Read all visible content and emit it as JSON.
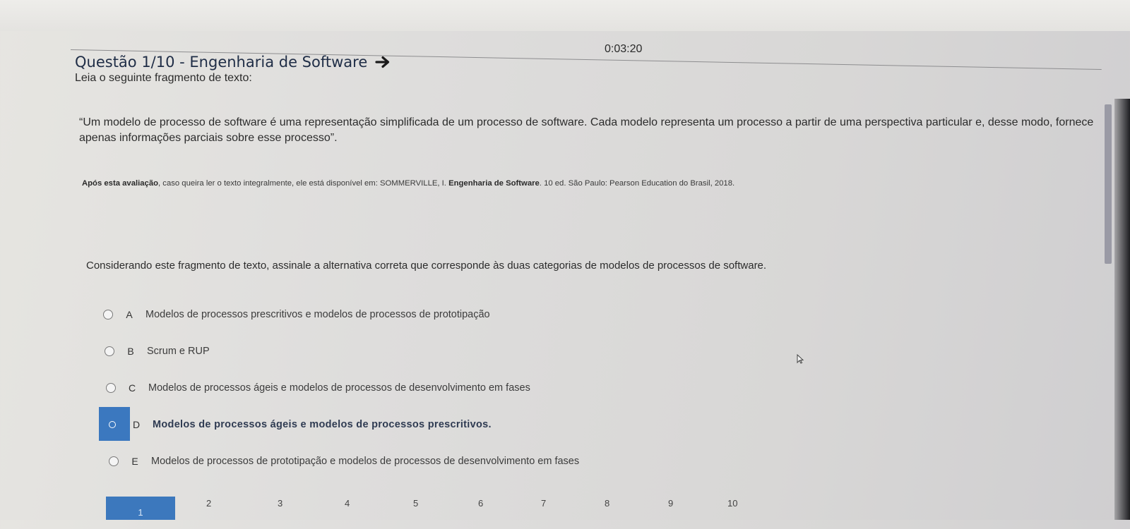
{
  "timer": "0:03:20",
  "question": {
    "title": "Questão 1/10 - Engenharia de Software",
    "intro": "Leia o seguinte fragmento de texto:",
    "quote": "“Um modelo de processo de software é uma representação simplificada de um processo de software. Cada modelo representa um processo a partir de uma perspectiva particular e, desse modo, fornece apenas informações parciais sobre esse processo”.",
    "source": {
      "lead": "Após esta avaliação",
      "middle": ", caso queira ler o texto integralmente, ele está disponível em: SOMMERVILLE, I. ",
      "book": "Engenharia de Software",
      "tail": ". 10 ed. São Paulo: Pearson Education do Brasil, 2018."
    },
    "prompt": "Considerando este fragmento de texto, assinale a alternativa correta que corresponde às duas categorias de modelos de processos de software."
  },
  "options": [
    {
      "letter": "A",
      "text": "Modelos de processos prescritivos e modelos de processos de prototipação",
      "selected": false
    },
    {
      "letter": "B",
      "text": "Scrum e RUP",
      "selected": false
    },
    {
      "letter": "C",
      "text": "Modelos de processos ágeis e modelos de processos de desenvolvimento em fases",
      "selected": false
    },
    {
      "letter": "D",
      "text": "Modelos de processos ágeis e modelos de processos prescritivos.",
      "selected": true
    },
    {
      "letter": "E",
      "text": "Modelos de processos de prototipação e modelos de processos de desenvolvimento em fases",
      "selected": false
    }
  ],
  "pager": {
    "current": "1",
    "pages": [
      "2",
      "3",
      "4",
      "5",
      "6",
      "7",
      "8",
      "9",
      "10"
    ]
  },
  "colors": {
    "accent": "#3b78bf",
    "title": "#1f2d46"
  },
  "icons": {
    "title_arrow": "arrow-right-icon",
    "pointer": "cursor-icon"
  }
}
